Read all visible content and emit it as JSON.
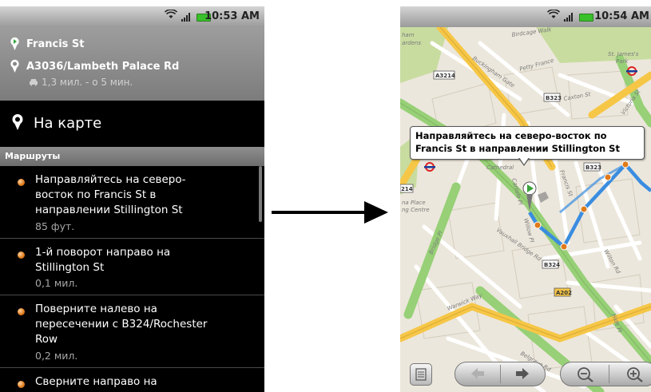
{
  "left": {
    "status": {
      "time": "10:53 AM"
    },
    "header": {
      "from": "Francis St",
      "to": "A3036/Lambeth Palace Rd",
      "summary": "1,3 мил. - о 5 мин."
    },
    "on_map_label": "На карте",
    "section_title": "Маршруты",
    "steps": [
      {
        "lines": [
          "Направляйтесь на северо-",
          "восток по Francis St в",
          "направлении Stillington St"
        ],
        "distance": "85 фут."
      },
      {
        "lines": [
          "1-й поворот направо на",
          "Stillington St"
        ],
        "distance": "0,1 мил."
      },
      {
        "lines": [
          "Поверните налево на",
          "пересечении с B324/Rochester",
          "Row"
        ],
        "distance": "0,2 мил."
      },
      {
        "lines": [
          "Сверните направо на"
        ],
        "distance": ""
      }
    ]
  },
  "right": {
    "status": {
      "time": "10:54 AM"
    },
    "balloon": {
      "line1": "Направляйтесь на северо-восток по",
      "line2": "Francis St в направлении Stillington St"
    },
    "map_labels": {
      "birdcage": "Birdcage Walk",
      "buckingham": "Buckingham Gate",
      "petty_france": "Petty France",
      "st_james": "St. James's",
      "park": "Park",
      "caxton": "Caxton St",
      "victoria": "Victoria St",
      "cathedral": "Cathedral",
      "ham": "ham",
      "gardens": "ardens",
      "na_place": "na Place",
      "ng_centre": "ng Centre",
      "bridge_pl": "Bridge Pl",
      "vauxhall": "Vauxhall Bridge Rd",
      "warwick": "Warwick Way",
      "belgrave": "Belgrave Rd",
      "francis": "Francis St",
      "carlisle": "Carlisle Pl",
      "willow": "Willow Pl",
      "wilton": "Wilton Rd",
      "hide": "Hide Pl"
    },
    "shields": [
      "A3214",
      "B323",
      "B323",
      "B324",
      "A202",
      "214"
    ]
  },
  "colors": {
    "route": "#3a8de0",
    "major_road": "#f6c646",
    "park": "#c8dca0",
    "green_road": "#97d077",
    "waypoint": "#e07a1a"
  }
}
